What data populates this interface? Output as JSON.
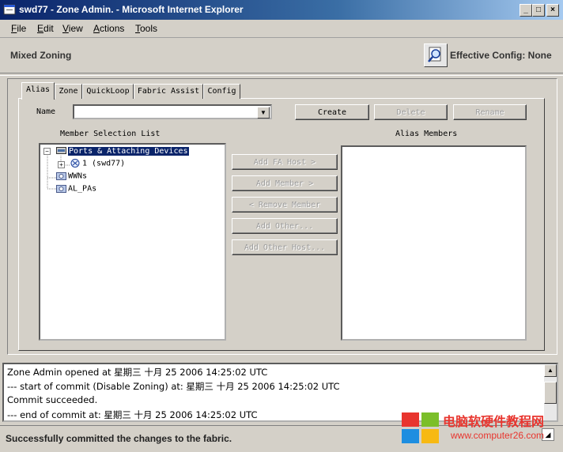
{
  "window": {
    "title": "swd77 - Zone Admin. - Microsoft Internet Explorer",
    "controls": [
      "_",
      "□",
      "×"
    ]
  },
  "menu": [
    "File",
    "Edit",
    "View",
    "Actions",
    "Tools"
  ],
  "header": {
    "mode_label": "Mixed Zoning",
    "effective_config": "Effective Config: None"
  },
  "tabs": [
    "Alias",
    "Zone",
    "QuickLoop",
    "Fabric Assist",
    "Config"
  ],
  "form": {
    "name_label": "Name",
    "name_value": "",
    "create": "Create",
    "delete": "Delete",
    "rename": "Rename"
  },
  "member_list": {
    "label": "Member Selection List",
    "tree": {
      "root": "Ports & Attaching Devices",
      "child": "1 (swd77)",
      "wwns": "WWNs",
      "alpas": "AL_PAs"
    }
  },
  "actions": {
    "add_fa_host": "Add FA Host >",
    "add_member": "Add Member >",
    "remove_member": "< Remove Member",
    "add_other": "Add Other...",
    "add_other_host": "Add Other Host..."
  },
  "alias_members": {
    "label": "Alias Members"
  },
  "log": [
    "Zone Admin opened at 星期三 十月 25 2006 14:25:02 UTC",
    "--- start of commit (Disable Zoning) at: 星期三 十月 25 2006 14:25:02 UTC",
    "Commit succeeded.",
    "--- end of commit at: 星期三 十月 25 2006 14:25:02 UTC"
  ],
  "status": "Successfully committed the changes to the fabric.",
  "watermark": {
    "name": "电脑软硬件教程网",
    "url": "www.computer26.com"
  },
  "colors": {
    "titlebar": "#0a246a",
    "selection": "#0a246a",
    "watermark_red": "#e8352e"
  }
}
